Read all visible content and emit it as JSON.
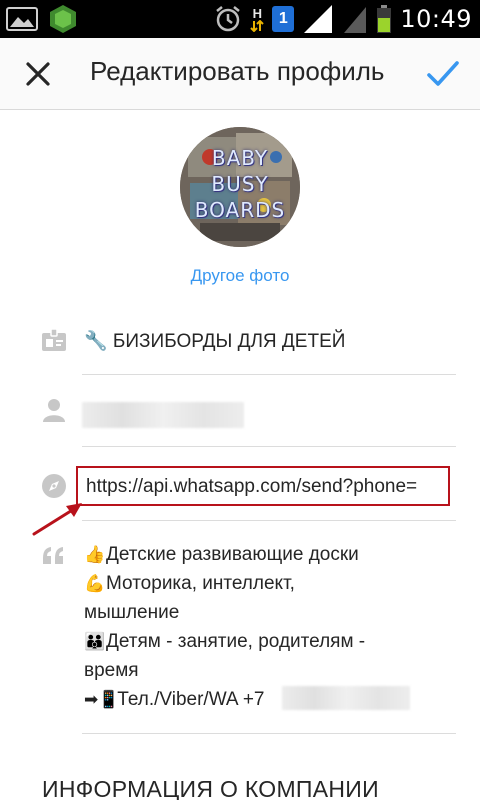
{
  "status_bar": {
    "network_type": "H",
    "sim_slot": "1",
    "time": "10:49"
  },
  "header": {
    "title": "Редактировать профиль",
    "close_icon": "close-icon",
    "confirm_icon": "checkmark-icon",
    "accent_color": "#3897f0"
  },
  "profile": {
    "avatar_text_lines": [
      "BABY",
      "BUSY",
      "BOARDS"
    ],
    "change_photo_label": "Другое фото"
  },
  "fields": {
    "name": {
      "icon": "id-card-icon",
      "value": "🔧 БИЗИБОРДЫ ДЛЯ ДЕТЕЙ"
    },
    "username": {
      "icon": "person-icon",
      "value_hidden": true
    },
    "website": {
      "icon": "compass-icon",
      "value": "https://api.whatsapp.com/send?phone=",
      "highlight_color": "#b8121b"
    },
    "bio": {
      "icon": "quote-icon",
      "lines": [
        {
          "emoji": "👍",
          "text": "Детские развивающие доски"
        },
        {
          "emoji": "💪",
          "text": "Моторика, интеллект,"
        },
        {
          "emoji": "",
          "text": "мышление"
        },
        {
          "emoji": "👪",
          "text": "Детям - занятие, родителям -"
        },
        {
          "emoji": "",
          "text": "время"
        },
        {
          "emoji": "➡📱",
          "text": "Тел./Viber/WA +7"
        }
      ]
    }
  },
  "company_section": {
    "title": "ИНФОРМАЦИЯ О КОМПАНИИ"
  }
}
